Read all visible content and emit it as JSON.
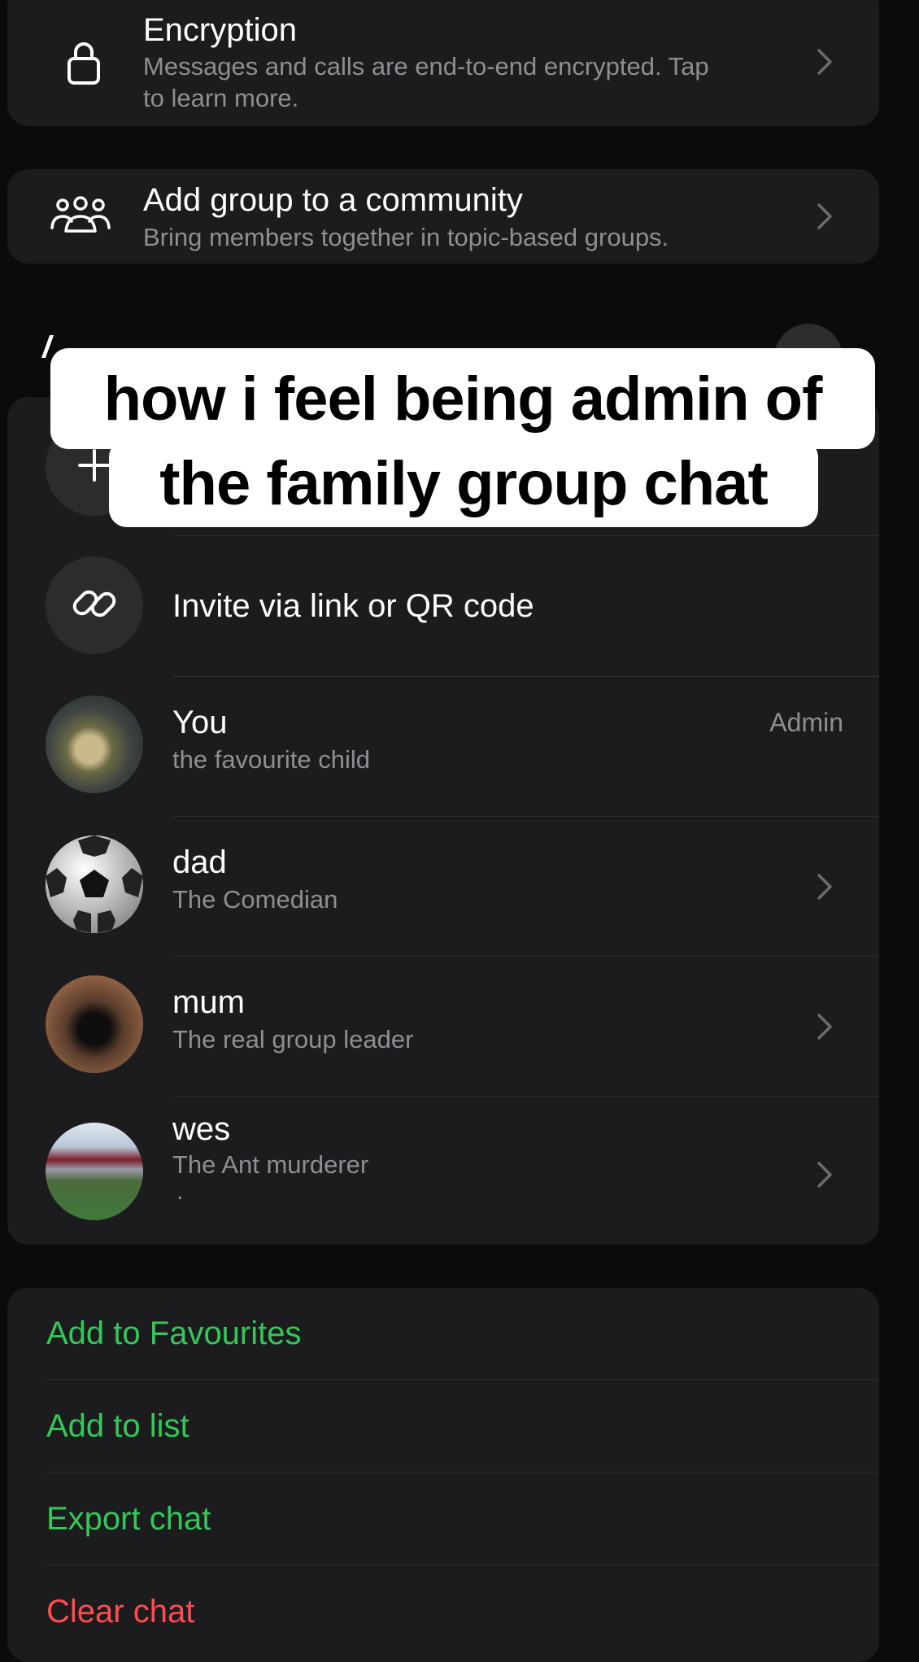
{
  "encryption": {
    "title": "Encryption",
    "subtitle_line1": "Messages and calls are end-to-end encrypted. Tap",
    "subtitle_line2": "to learn more.",
    "icon": "lock-icon"
  },
  "community": {
    "title": "Add group to a community",
    "subtitle": "Bring members together in topic-based groups.",
    "icon": "community-icon"
  },
  "members_section": {
    "add_icon": "plus-icon",
    "invite_label": "Invite via link or QR code",
    "invite_icon": "link-icon",
    "members": [
      {
        "name": "You",
        "about": "the favourite child",
        "badge": "Admin"
      },
      {
        "name": "dad",
        "about": "The Comedian"
      },
      {
        "name": "mum",
        "about": "The real group leader"
      },
      {
        "name": "wes",
        "about": "The Ant murderer",
        "extra": "."
      }
    ]
  },
  "actions": {
    "favourites": "Add to Favourites",
    "add_list": "Add to list",
    "export": "Export chat",
    "clear": "Clear chat"
  },
  "caption": {
    "line1": "how i feel being admin of",
    "line2": "the family group chat"
  },
  "colors": {
    "background": "#0b0b0b",
    "card": "#1c1c1e",
    "accent_green": "#34c759",
    "destructive_red": "#ff4d4f",
    "secondary_text": "#8e8e93"
  }
}
